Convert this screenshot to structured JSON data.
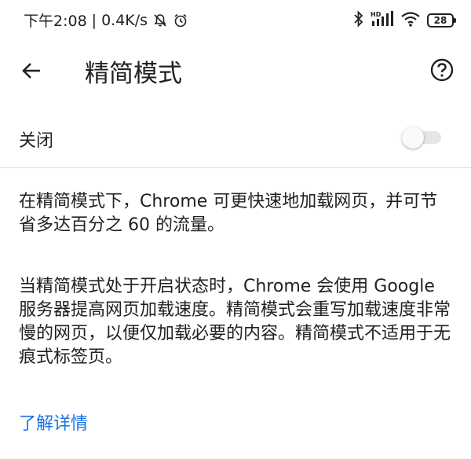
{
  "status_bar": {
    "time": "下午2:08",
    "separator": "|",
    "net_speed": "0.4K/s",
    "left_icons": [
      "bell-off-icon",
      "alarm-icon"
    ],
    "right_icons": [
      "bluetooth-icon",
      "hd-signal-icon",
      "wifi-icon"
    ],
    "hd_label": "HD",
    "battery_level": "28"
  },
  "appbar": {
    "back_icon": "arrow-back-icon",
    "title": "精简模式",
    "help_icon": "help-circle-icon"
  },
  "toggle": {
    "label": "关闭",
    "state": "off"
  },
  "description": {
    "paragraph1": "在精简模式下，Chrome 可更快速地加载网页，并可节省多达百分之 60 的流量。",
    "paragraph2": "当精简模式处于开启状态时，Chrome 会使用 Google 服务器提高网页加载速度。精简模式会重写加载速度非常慢的网页，以便仅加载必要的内容。精简模式不适用于无痕式标签页。"
  },
  "link": {
    "label": "了解详情"
  },
  "colors": {
    "text": "#202124",
    "link": "#1a73e8",
    "divider": "#dadce0",
    "switch_track_off": "#e6e6e6"
  }
}
